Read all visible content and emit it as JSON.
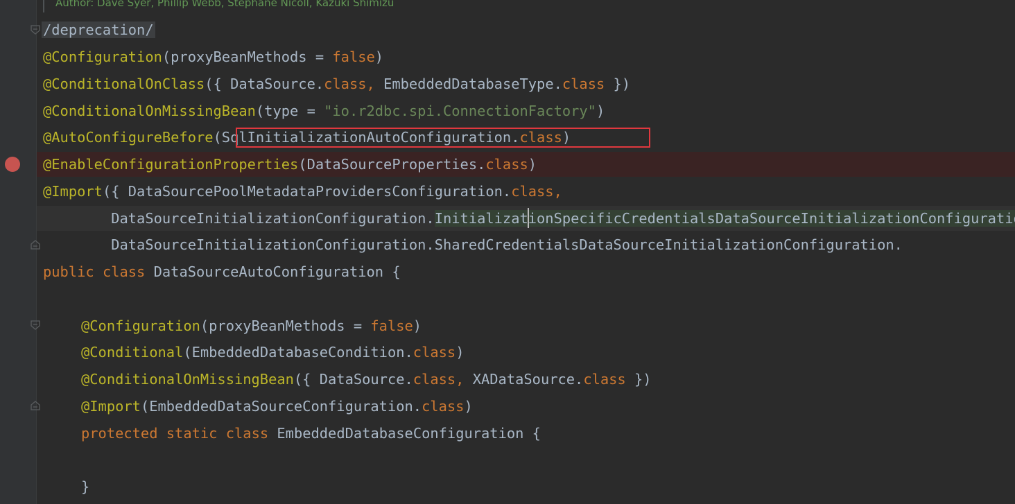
{
  "doc_comment": {
    "author_line": "Author: Dave Syer, Phillip Webb, Stephane Nicoll, Kazuki Shimizu"
  },
  "code": {
    "line_deprecation": "/deprecation/",
    "l1_ann": "@Configuration",
    "l1_open": "(proxyBeanMethods = ",
    "l1_val": "false",
    "l1_close": ")",
    "l2_ann": "@ConditionalOnClass",
    "l2_a": "({ DataSource.",
    "l2_kw1": "class,",
    "l2_b": " EmbeddedDatabaseType.",
    "l2_kw2": "class",
    "l2_c": " })",
    "l3_ann": "@ConditionalOnMissingBean",
    "l3_a": "(type = ",
    "l3_str": "\"io.r2dbc.spi.ConnectionFactory\"",
    "l3_b": ")",
    "l4_ann": "@AutoConfigureBefore",
    "l4_a": "(SqlInitializationAutoConfiguration.",
    "l4_kw": "class",
    "l4_b": ")",
    "l5_ann": "@EnableConfigurationProperties",
    "l5_a": "(DataSourceProperties.",
    "l5_kw": "class",
    "l5_b": ")",
    "l6_ann": "@Import",
    "l6_a": "({ DataSourcePoolMetadataProvidersConfiguration.",
    "l6_kw": "class,",
    "l7_a": "        DataSourceInitializationConfiguration.",
    "l7_b": "InitializationSpecificCredentialsDataSourceInitializationConfiguration.",
    "l8_a": "        DataSourceInitializationConfiguration.",
    "l8_b": "SharedCredentialsDataSourceInitializationConfiguration.",
    "l9_kw1": "public",
    "l9_kw2": "class",
    "l9_a": " DataSourceAutoConfiguration {",
    "l11_ann": "@Configuration",
    "l11_a": "(proxyBeanMethods = ",
    "l11_val": "false",
    "l11_b": ")",
    "l12_ann": "@Conditional",
    "l12_a": "(EmbeddedDatabaseCondition.",
    "l12_kw": "class",
    "l12_b": ")",
    "l13_ann": "@ConditionalOnMissingBean",
    "l13_a": "({ DataSource.",
    "l13_kw1": "class,",
    "l13_b": " XADataSource.",
    "l13_kw2": "class",
    "l13_c": " })",
    "l14_ann": "@Import",
    "l14_a": "(EmbeddedDataSourceConfiguration.",
    "l14_kw": "class",
    "l14_b": ")",
    "l15_kw1": "protected",
    "l15_kw2": "static",
    "l15_kw3": "class",
    "l15_a": " EmbeddedDatabaseConfiguration {",
    "l17_a": "}"
  },
  "colors": {
    "background": "#2b2b2b",
    "gutter": "#313335",
    "annotation": "#bbb529",
    "keyword": "#cc7832",
    "string": "#6a8759",
    "identifier": "#a9b7c6",
    "breakpoint": "#c75450",
    "breakpoint_line": "#3a2323",
    "highlight_box": "#e0383e"
  },
  "icons": {
    "breakpoint": "breakpoint-icon",
    "fold": "fold-icon"
  }
}
